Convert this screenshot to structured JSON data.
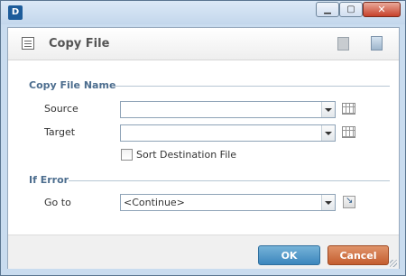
{
  "app": {
    "icon_text": "D"
  },
  "header": {
    "title": "Copy File"
  },
  "copy_section": {
    "title": "Copy File Name",
    "source_label": "Source",
    "source_value": "",
    "target_label": "Target",
    "target_value": "",
    "sort_label": "Sort Destination File",
    "sort_checked": false
  },
  "error_section": {
    "title": "If Error",
    "goto_label": "Go to",
    "goto_value": "<Continue>"
  },
  "footer": {
    "ok_label": "OK",
    "cancel_label": "Cancel"
  }
}
